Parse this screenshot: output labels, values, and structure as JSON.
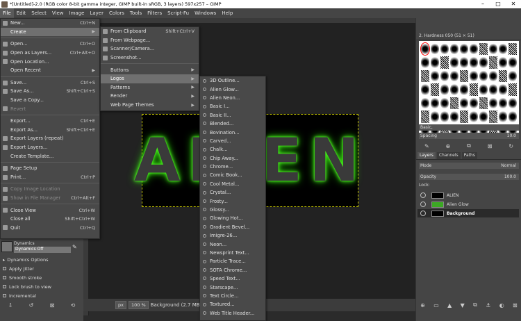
{
  "window": {
    "title": "*[Untitled]-2.0 (RGB color 8-bit gamma integer, GIMP built-in sRGB, 3 layers) 597x257 – GIMP",
    "controls": [
      "–",
      "□",
      "✕"
    ]
  },
  "menubar": {
    "items": [
      "File",
      "Edit",
      "Select",
      "View",
      "Image",
      "Layer",
      "Colors",
      "Tools",
      "Filters",
      "Script-Fu",
      "Windows",
      "Help"
    ]
  },
  "file_menu": [
    {
      "label": "New...",
      "accel": "Ctrl+N"
    },
    {
      "label": "Create",
      "submenu": true,
      "highlight": true
    },
    {
      "sep": true
    },
    {
      "label": "Open...",
      "accel": "Ctrl+O"
    },
    {
      "label": "Open as Layers...",
      "accel": "Ctrl+Alt+O"
    },
    {
      "label": "Open Location..."
    },
    {
      "label": "Open Recent",
      "submenu": true
    },
    {
      "sep": true
    },
    {
      "label": "Save...",
      "accel": "Ctrl+S"
    },
    {
      "label": "Save As...",
      "accel": "Shift+Ctrl+S"
    },
    {
      "label": "Save a Copy..."
    },
    {
      "label": "Revert",
      "disabled": true
    },
    {
      "sep": true
    },
    {
      "label": "Export...",
      "accel": "Ctrl+E"
    },
    {
      "label": "Export As...",
      "accel": "Shift+Ctrl+E"
    },
    {
      "label": "Export Layers (repeat)"
    },
    {
      "label": "Export Layers..."
    },
    {
      "label": "Create Template..."
    },
    {
      "sep": true
    },
    {
      "label": "Page Setup"
    },
    {
      "label": "Print...",
      "accel": "Ctrl+P"
    },
    {
      "sep": true
    },
    {
      "label": "Copy Image Location",
      "disabled": true
    },
    {
      "label": "Show in File Manager",
      "accel": "Ctrl+Alt+F",
      "disabled": true
    },
    {
      "sep": true
    },
    {
      "label": "Close View",
      "accel": "Ctrl+W"
    },
    {
      "label": "Close all",
      "accel": "Shift+Ctrl+W"
    },
    {
      "label": "Quit",
      "accel": "Ctrl+Q"
    }
  ],
  "create_menu": [
    {
      "label": "From Clipboard",
      "accel": "Shift+Ctrl+V"
    },
    {
      "label": "From Webpage..."
    },
    {
      "label": "Scanner/Camera..."
    },
    {
      "label": "Screenshot..."
    },
    {
      "sep": true
    },
    {
      "label": "Buttons",
      "submenu": true
    },
    {
      "label": "Logos",
      "submenu": true,
      "highlight": true
    },
    {
      "label": "Patterns",
      "submenu": true
    },
    {
      "label": "Render",
      "submenu": true
    },
    {
      "label": "Web Page Themes",
      "submenu": true
    }
  ],
  "logos_menu": [
    "3D Outline...",
    "Alien Glow...",
    "Alien Neon...",
    "Basic I...",
    "Basic II...",
    "Blended...",
    "Bovination...",
    "Carved...",
    "Chalk...",
    "Chip Away...",
    "Chrome...",
    "Comic Book...",
    "Cool Metal...",
    "Crystal...",
    "Frosty...",
    "Glossy...",
    "Glowing Hot...",
    "Gradient Bevel...",
    "Imigre-26...",
    "Neon...",
    "Newsprint Text...",
    "Particle Trace...",
    "SOTA Chrome...",
    "Speed Text...",
    "Starscape...",
    "Text Circle...",
    "Textured...",
    "Web Title Header..."
  ],
  "canvas": {
    "text": "ALIEN",
    "glow_color": "#4cff1c"
  },
  "statusbar": {
    "unit": "px",
    "zoom": "100 %",
    "info": "Background (2.7 MB)"
  },
  "tool_options": {
    "dynamics_label": "Dynamics",
    "dynamics_value": "Dynamics Off",
    "options": [
      "Dynamics Options",
      "Apply Jitter",
      "Smooth stroke",
      "Lock brush to view",
      "Incremental"
    ]
  },
  "brushes": {
    "title": "2. Hardness 050 (51 × 51)",
    "filter": "Basic,",
    "spacing_label": "Spacing",
    "spacing_value": "10.0"
  },
  "layers": {
    "tabs": [
      "Layers",
      "Channels",
      "Paths"
    ],
    "mode_label": "Mode",
    "mode_value": "Normal",
    "opacity_label": "Opacity",
    "opacity_value": "100.0",
    "lock_label": "Lock:",
    "items": [
      {
        "name": "ALIEN",
        "thumb": "dark"
      },
      {
        "name": "Alien Glow",
        "thumb": "green"
      },
      {
        "name": "Background",
        "thumb": "dark",
        "selected": true
      }
    ]
  }
}
